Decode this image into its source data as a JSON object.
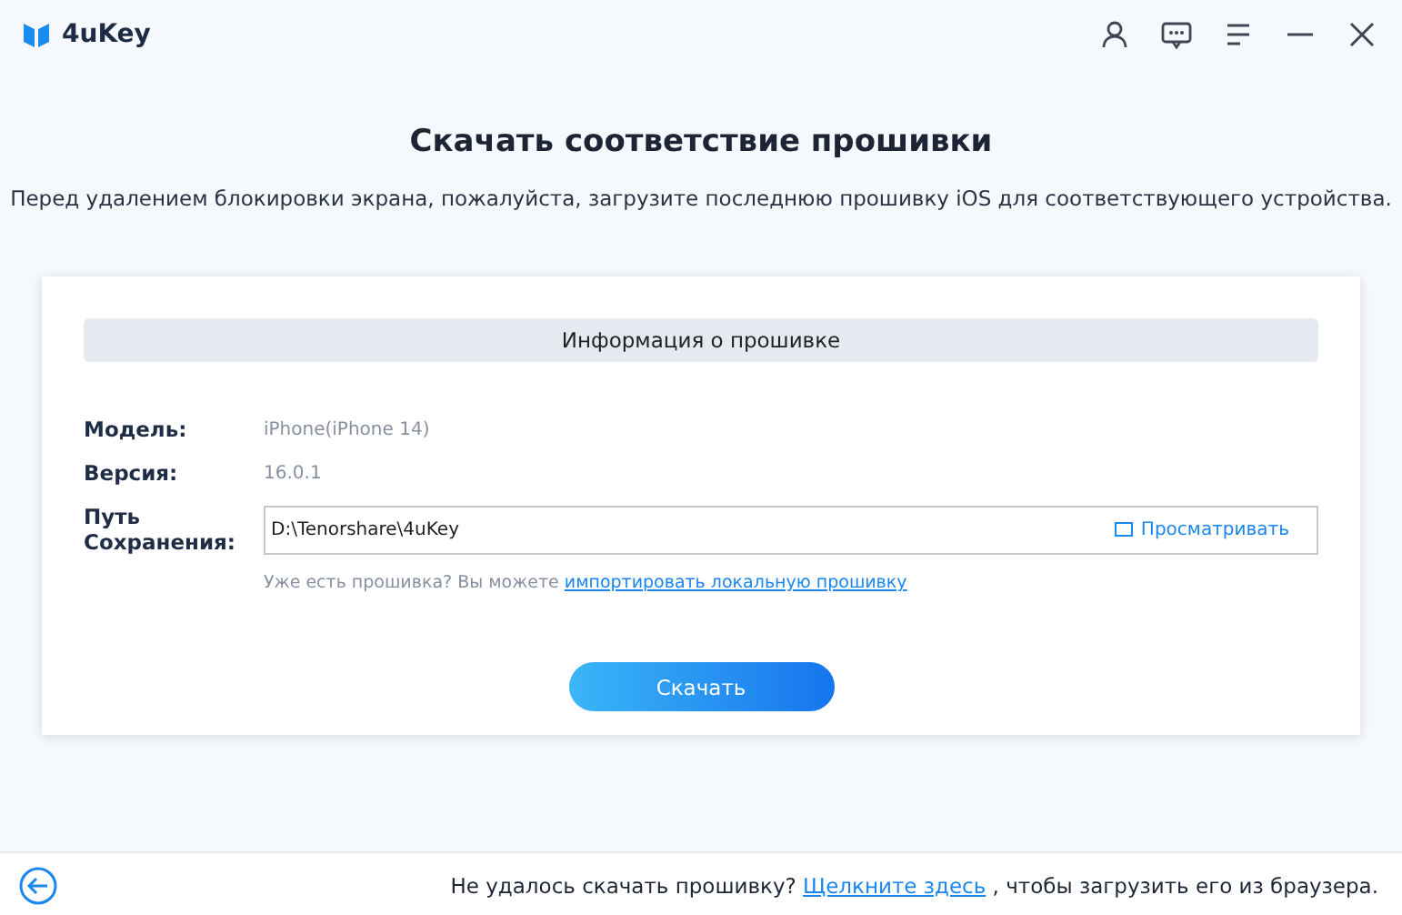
{
  "app": {
    "name": "4uKey"
  },
  "heading": "Скачать соответствие прошивки",
  "subtitle": "Перед удалением блокировки экрана, пожалуйста, загрузите последнюю прошивку iOS для соответствующего устройства.",
  "panel": {
    "title": "Информация о прошивке",
    "fields": [
      {
        "label": "Модель:",
        "value": "iPhone(iPhone 14)"
      },
      {
        "label": "Версия:",
        "value": "16.0.1"
      }
    ],
    "save_path": {
      "label": "Путь Сохранения:",
      "value": "D:\\Tenorshare\\4uKey",
      "browse": "Просматривать"
    },
    "import_hint": {
      "text": "Уже есть прошивка? Вы можете ",
      "link": "импортировать локальную прошивку"
    },
    "download_button": "Скачать"
  },
  "footer": {
    "text": "Не удалось скачать прошивку? ",
    "link": "Щелкните здесь",
    "after": " , чтобы загрузить его из браузера."
  }
}
